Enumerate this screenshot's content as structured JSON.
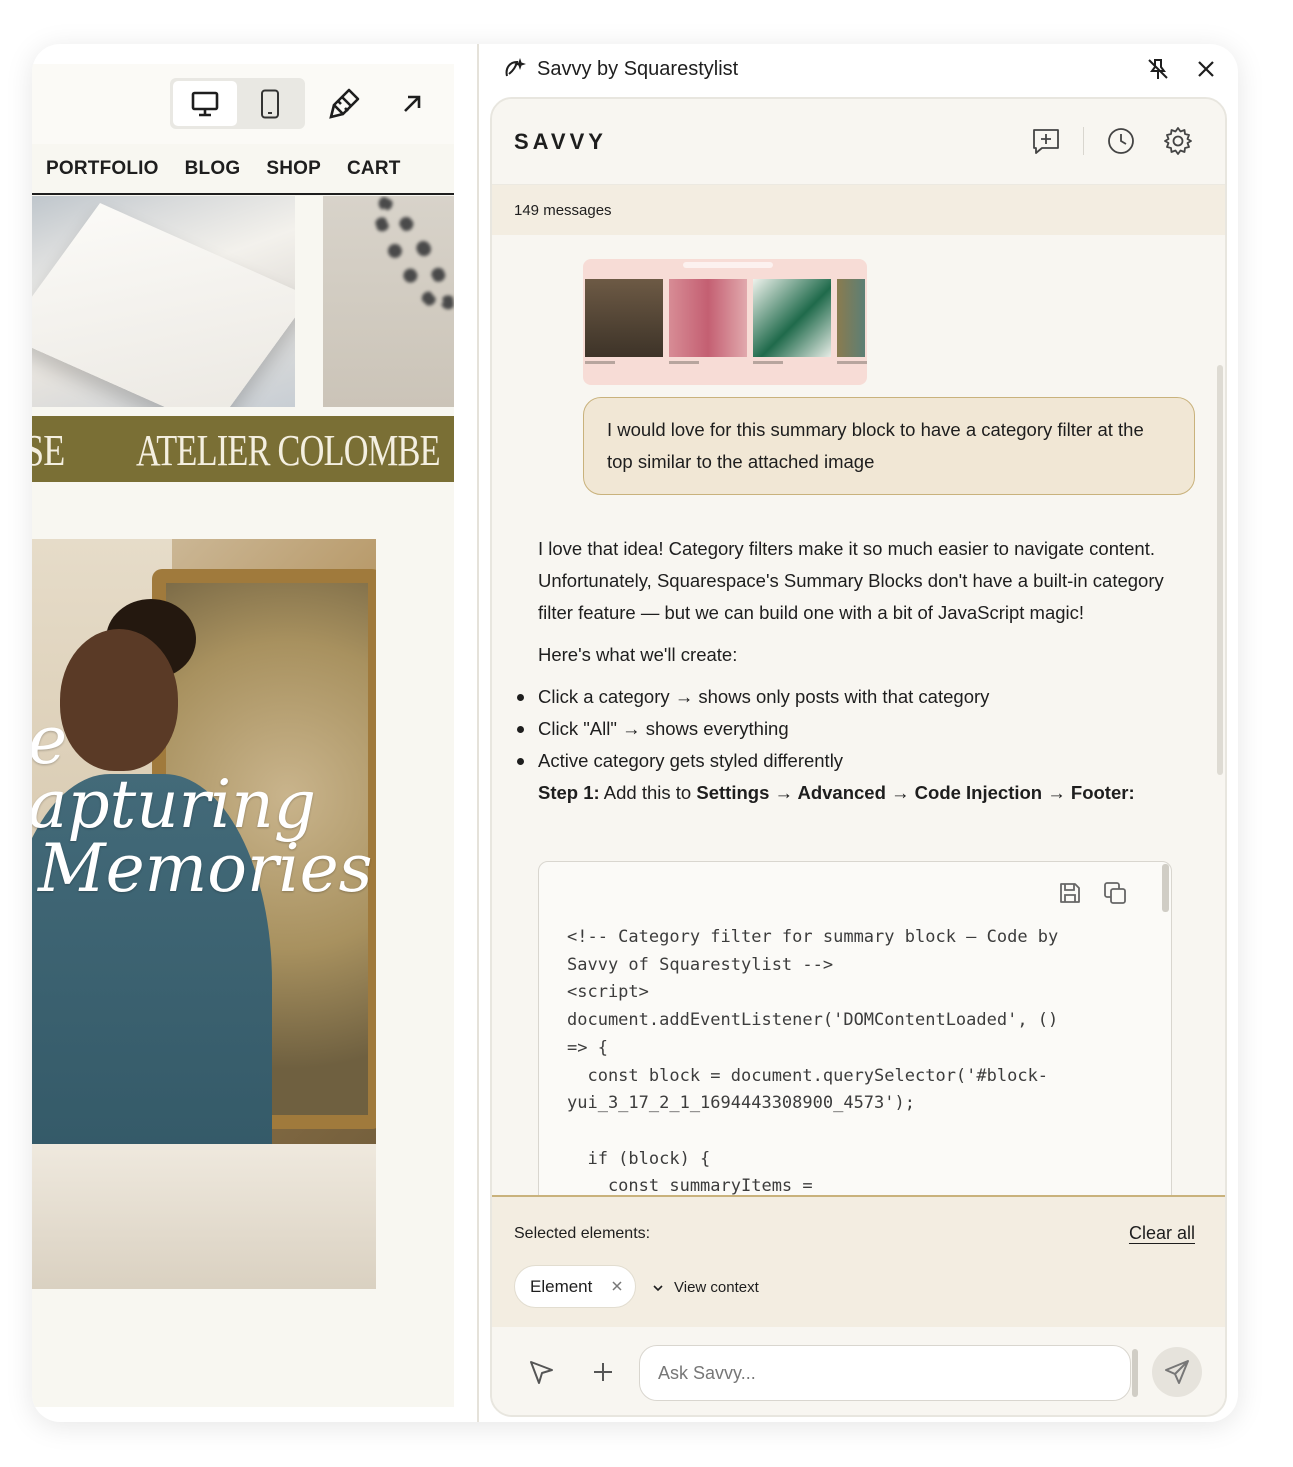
{
  "preview": {
    "toolbar": {
      "desktop_icon": "desktop-icon",
      "mobile_icon": "mobile-icon",
      "style_icon": "paintbrush-icon",
      "open_icon": "arrow-up-right-icon"
    },
    "nav": [
      "PORTFOLIO",
      "BLOG",
      "SHOP",
      "CART"
    ],
    "marquee_left": "SE",
    "marquee_text": "ATELIER COLOMBE",
    "script_line1": "e",
    "script_line2": "apturing",
    "script_line3": "Memories"
  },
  "panel": {
    "title": "Savvy by Squarestylist",
    "brand": "SAVVY",
    "message_count": "149 messages",
    "user_message": "I would love for this summary block to have a category filter at the top similar to the attached image",
    "reply": {
      "intro": "I love that idea! Category filters make it so much easier to navigate content. Unfortunately, Squarespace's Summary Blocks don't have a built-in category filter feature — but we can build one with a bit of JavaScript magic!",
      "lead": "Here's what we'll create:",
      "bullets": [
        "Click a category → shows only posts with that category",
        "Click \"All\" → shows everything",
        "Active category gets styled differently"
      ],
      "step_label": "Step 1:",
      "step_text1": " Add this to ",
      "step_settings": "Settings",
      "step_advanced": "Advanced",
      "step_injection": "Code Injection",
      "step_footer": "Footer:",
      "arrow": " → "
    },
    "code": "<!-- Category filter for summary block — Code by\nSavvy of Squarestylist -->\n<script>\ndocument.addEventListener('DOMContentLoaded', ()\n=> {\n  const block = document.querySelector('#block-\nyui_3_17_2_1_1694443308900_4573');\n\n  if (block) {\n    const summaryItems =",
    "context": {
      "selected_label": "Selected elements:",
      "clear_all": "Clear all",
      "chip_label": "Element",
      "view_context": "View context"
    },
    "composer": {
      "placeholder": "Ask Savvy..."
    }
  },
  "colors": {
    "marquee": "#7a6f35",
    "bubble": "#f1e7d5",
    "bubble_border": "#c9b27c",
    "count_bar": "#f3ede1"
  }
}
